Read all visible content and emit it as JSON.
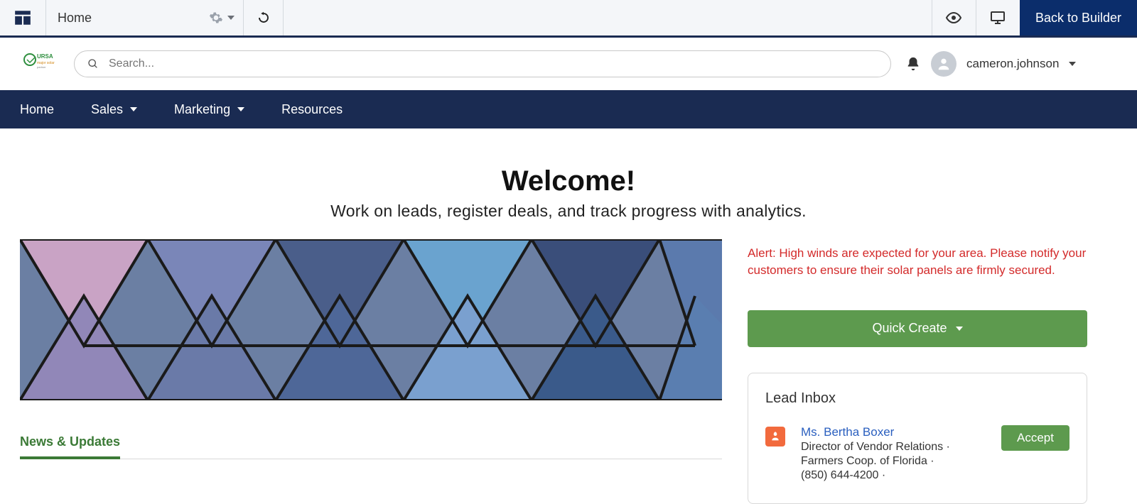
{
  "builder": {
    "page_label": "Home",
    "back_label": "Back to Builder"
  },
  "search": {
    "placeholder": "Search..."
  },
  "user": {
    "name": "cameron.johnson"
  },
  "nav": {
    "items": [
      {
        "label": "Home",
        "has_menu": false
      },
      {
        "label": "Sales",
        "has_menu": true
      },
      {
        "label": "Marketing",
        "has_menu": true
      },
      {
        "label": "Resources",
        "has_menu": false
      }
    ]
  },
  "colors": {
    "nav_bg": "#1a2b52",
    "accent_green": "#5d9a4e",
    "alert_red": "#d32a2a",
    "link_blue": "#2a5fbf"
  },
  "hero": {
    "title": "Welcome!",
    "subtitle": "Work on leads, register deals, and track progress with analytics."
  },
  "news": {
    "tab_label": "News & Updates"
  },
  "alert": {
    "text": "Alert: High winds are expected for your area. Please notify your customers to ensure their solar panels are firmly secured."
  },
  "quick_create": {
    "label": "Quick Create"
  },
  "leads": {
    "title": "Lead Inbox",
    "items": [
      {
        "name": "Ms. Bertha Boxer",
        "line2": "Director of Vendor Relations  ·",
        "line3": "Farmers Coop. of Florida  ·",
        "line4": "(850) 644-4200  ·",
        "accept": "Accept"
      }
    ]
  }
}
